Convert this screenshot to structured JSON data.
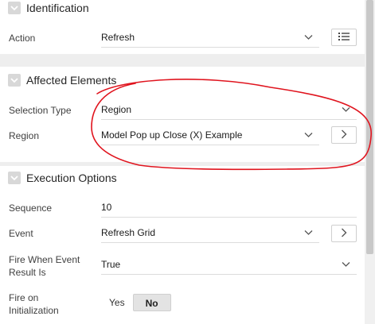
{
  "identification": {
    "title": "Identification",
    "action_label": "Action",
    "action_value": "Refresh"
  },
  "affected": {
    "title": "Affected Elements",
    "selection_type_label": "Selection Type",
    "selection_type_value": "Region",
    "region_label": "Region",
    "region_value": "Model Pop up Close (X) Example"
  },
  "execution": {
    "title": "Execution Options",
    "sequence_label": "Sequence",
    "sequence_value": "10",
    "event_label": "Event",
    "event_value": "Refresh Grid",
    "fire_when_label_1": "Fire When Event",
    "fire_when_label_2": "Result Is",
    "fire_when_value": "True",
    "fire_init_label_1": "Fire on",
    "fire_init_label_2": "Initialization",
    "toggle_yes": "Yes",
    "toggle_no": "No",
    "toggle_selected": "No"
  },
  "icons": {
    "collapse": "chevron-down-icon",
    "list": "list-icon",
    "go": "chevron-right-icon"
  },
  "colors": {
    "annotation": "#e0141e",
    "panel_gap": "#eeeeee"
  }
}
